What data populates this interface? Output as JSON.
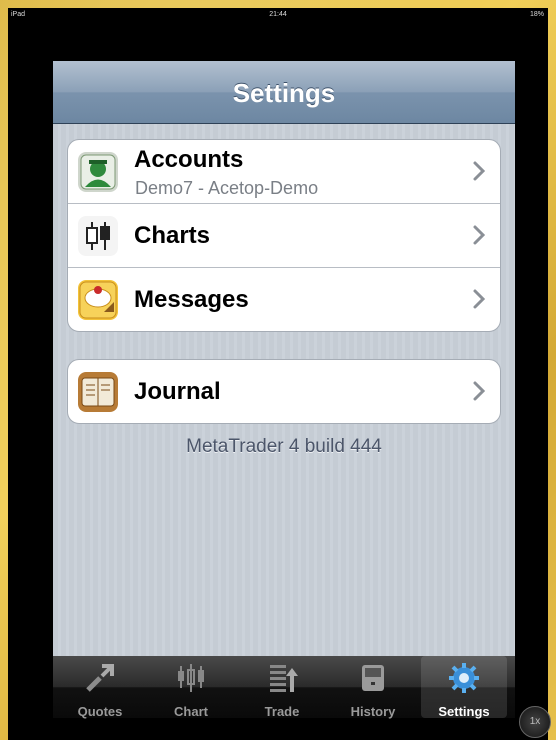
{
  "status": {
    "device": "iPad",
    "time": "21:44",
    "battery": "18%"
  },
  "nav": {
    "title": "Settings"
  },
  "groups": {
    "main": [
      {
        "label": "Accounts",
        "sub": "Demo7 - Acetop-Demo",
        "icon": "accounts-icon"
      },
      {
        "label": "Charts",
        "icon": "charts-icon"
      },
      {
        "label": "Messages",
        "icon": "messages-icon"
      }
    ],
    "secondary": [
      {
        "label": "Journal",
        "icon": "journal-icon"
      }
    ]
  },
  "footer": "MetaTrader 4 build 444",
  "tabs": [
    {
      "label": "Quotes",
      "icon": "quotes-icon",
      "active": false
    },
    {
      "label": "Chart",
      "icon": "candlestick-chart-icon",
      "active": false
    },
    {
      "label": "Trade",
      "icon": "trade-icon",
      "active": false
    },
    {
      "label": "History",
      "icon": "history-icon",
      "active": false
    },
    {
      "label": "Settings",
      "icon": "gear-icon",
      "active": true
    }
  ],
  "zoom": "1x",
  "colors": {
    "nav_title": "#ffffff",
    "tab_active": "#ffffff",
    "tab_inactive": "#9a9a9a"
  }
}
